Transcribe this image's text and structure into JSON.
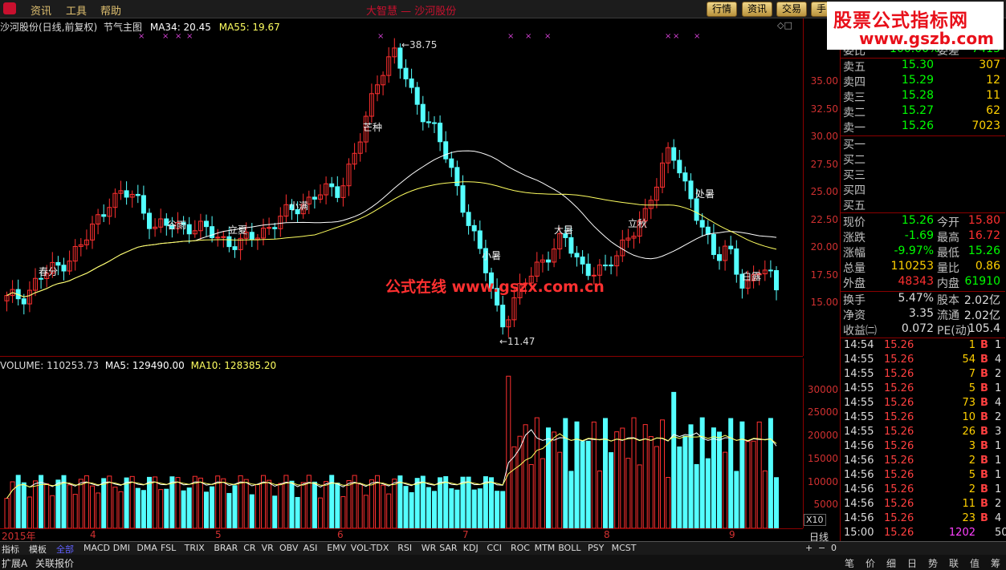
{
  "menu": {
    "items": [
      "资讯",
      "工具",
      "帮助"
    ],
    "window_title": "大智慧 — 沙河股份"
  },
  "top_tabs": [
    "行情",
    "资讯",
    "交易",
    "手"
  ],
  "watermark": {
    "title": "股票公式指标网",
    "url": "www.gszb.com"
  },
  "price_panel": {
    "legend_name": "沙河股份(日线,前复权)",
    "indicator": "节气主图",
    "ma34": "MA34: 20.45",
    "ma55": "MA55: 19.67",
    "high_label": "38.75",
    "low_label": "11.47",
    "center_watermark": "公式在线 www.gszx.com.cn",
    "axis_ticks": [
      "35.00",
      "32.50",
      "30.00",
      "27.50",
      "25.00",
      "22.50",
      "20.00",
      "17.50",
      "15.00"
    ],
    "term_labels": [
      "春分",
      "谷雨",
      "立夏",
      "小满",
      "芒种",
      "小暑",
      "大暑",
      "立秋",
      "处暑",
      "白露"
    ],
    "colors": {
      "up": "#ff3030",
      "down": "#54ffff",
      "ma34": "#ffffff",
      "ma55": "#ffff60"
    }
  },
  "volume_panel": {
    "legend": "VOLUME: 110253.73",
    "ma5": "MA5: 129490.00",
    "ma10": "MA10: 128385.20",
    "axis_ticks": [
      "30000",
      "25000",
      "20000",
      "15000",
      "10000",
      "5000"
    ],
    "unit_label": "X10"
  },
  "date_axis": {
    "labels": [
      "2015年",
      "4",
      "5",
      "6",
      "7",
      "8",
      "9"
    ],
    "period": "日线"
  },
  "indicator_tabs": [
    "指标",
    "模板",
    "全部",
    "MACD",
    "DMI",
    "DMA",
    "FSL",
    "TRIX",
    "BRAR",
    "CR",
    "VR",
    "OBV",
    "ASI",
    "EMV",
    "VOL-TDX",
    "RSI",
    "WR",
    "SAR",
    "KDJ",
    "CCI",
    "ROC",
    "MTM",
    "BOLL",
    "PSY",
    "MCST"
  ],
  "extra_bar": {
    "expand": "扩展A",
    "linked": "关联报价"
  },
  "quote": {
    "order_ratio": {
      "label": "委比",
      "value": "-100.00%",
      "label2": "委差",
      "value2": "-7415"
    },
    "sell": [
      {
        "label": "卖五",
        "price": "15.30",
        "vol": "307"
      },
      {
        "label": "卖四",
        "price": "15.29",
        "vol": "12"
      },
      {
        "label": "卖三",
        "price": "15.28",
        "vol": "11"
      },
      {
        "label": "卖二",
        "price": "15.27",
        "vol": "62"
      },
      {
        "label": "卖一",
        "price": "15.26",
        "vol": "7023"
      }
    ],
    "buy": [
      "买一",
      "买二",
      "买三",
      "买四",
      "买五"
    ],
    "stats": [
      {
        "l1": "现价",
        "v1": "15.26",
        "c1": "#00ff00",
        "l2": "今开",
        "v2": "15.80",
        "c2": "#ff3030"
      },
      {
        "l1": "涨跌",
        "v1": "-1.69",
        "c1": "#00ff00",
        "l2": "最高",
        "v2": "16.72",
        "c2": "#ff3030"
      },
      {
        "l1": "涨幅",
        "v1": "-9.97%",
        "c1": "#00ff00",
        "l2": "最低",
        "v2": "15.26",
        "c2": "#00ff00"
      },
      {
        "l1": "总量",
        "v1": "110253",
        "c1": "#ffd000",
        "l2": "量比",
        "v2": "0.86",
        "c2": "#ffd000"
      },
      {
        "l1": "外盘",
        "v1": "48343",
        "c1": "#ff3030",
        "l2": "内盘",
        "v2": "61910",
        "c2": "#00ff00"
      }
    ],
    "stats2": [
      {
        "l1": "换手",
        "v1": "5.47%",
        "l2": "股本",
        "v2": "2.02亿"
      },
      {
        "l1": "净资",
        "v1": "3.35",
        "l2": "流通",
        "v2": "2.02亿"
      },
      {
        "l1": "收益㈡",
        "v1": "0.072",
        "l2": "PE(动)",
        "v2": "105.4"
      }
    ],
    "ticks": [
      {
        "time": "14:54",
        "price": "15.26",
        "vol": "1",
        "flag": "B",
        "cnt": "1"
      },
      {
        "time": "14:55",
        "price": "15.26",
        "vol": "54",
        "flag": "B",
        "cnt": "4"
      },
      {
        "time": "14:55",
        "price": "15.26",
        "vol": "7",
        "flag": "B",
        "cnt": "2"
      },
      {
        "time": "14:55",
        "price": "15.26",
        "vol": "5",
        "flag": "B",
        "cnt": "1"
      },
      {
        "time": "14:55",
        "price": "15.26",
        "vol": "73",
        "flag": "B",
        "cnt": "4"
      },
      {
        "time": "14:55",
        "price": "15.26",
        "vol": "10",
        "flag": "B",
        "cnt": "2"
      },
      {
        "time": "14:55",
        "price": "15.26",
        "vol": "26",
        "flag": "B",
        "cnt": "3"
      },
      {
        "time": "14:56",
        "price": "15.26",
        "vol": "3",
        "flag": "B",
        "cnt": "1"
      },
      {
        "time": "14:56",
        "price": "15.26",
        "vol": "2",
        "flag": "B",
        "cnt": "1"
      },
      {
        "time": "14:56",
        "price": "15.26",
        "vol": "5",
        "flag": "B",
        "cnt": "1"
      },
      {
        "time": "14:56",
        "price": "15.26",
        "vol": "2",
        "flag": "B",
        "cnt": "1"
      },
      {
        "time": "14:56",
        "price": "15.26",
        "vol": "11",
        "flag": "B",
        "cnt": "2"
      },
      {
        "time": "14:56",
        "price": "15.26",
        "vol": "23",
        "flag": "B",
        "cnt": "4"
      },
      {
        "time": "15:00",
        "price": "15.26",
        "vol": "1202",
        "flag": "",
        "cnt": "50"
      }
    ],
    "bottom_tabs": [
      "笔",
      "价",
      "细",
      "日",
      "势",
      "联",
      "值",
      "筹"
    ]
  }
}
